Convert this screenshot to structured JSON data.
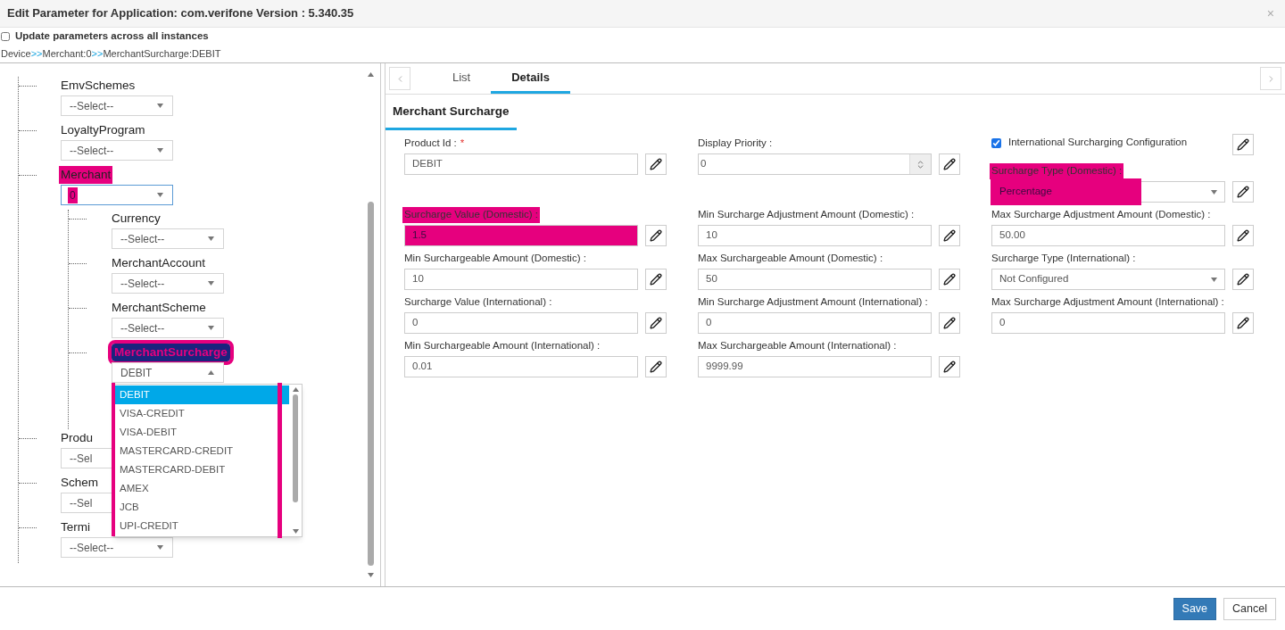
{
  "dialog": {
    "title": "Edit Parameter for Application: com.verifone Version : 5.340.35",
    "close": "×"
  },
  "update_all": {
    "label": "Update parameters across all instances",
    "checked": false
  },
  "breadcrumb": [
    {
      "label": "Device"
    },
    {
      "label": "Merchant:0"
    },
    {
      "label": "MerchantSurcharge:DEBIT"
    }
  ],
  "breadcrumb_separator": ">>",
  "tree": [
    {
      "label": "EmvSchemes",
      "selected": false,
      "label_highlighted": false,
      "select": {
        "value": "--Select--",
        "focused": false,
        "open": false,
        "value_highlighted": false
      }
    },
    {
      "label": "LoyaltyProgram",
      "selected": false,
      "label_highlighted": false,
      "select": {
        "value": "--Select--",
        "focused": false,
        "open": false,
        "value_highlighted": false
      }
    },
    {
      "label": "Merchant",
      "selected": false,
      "label_highlighted": true,
      "select": {
        "value": "0",
        "focused": true,
        "open": false,
        "value_highlighted": true
      },
      "children": [
        {
          "label": "Currency",
          "selected": false,
          "label_highlighted": false,
          "select": {
            "value": "--Select--",
            "focused": false,
            "open": false,
            "value_highlighted": false
          }
        },
        {
          "label": "MerchantAccount",
          "selected": false,
          "label_highlighted": false,
          "select": {
            "value": "--Select--",
            "focused": false,
            "open": false,
            "value_highlighted": false
          }
        },
        {
          "label": "MerchantScheme",
          "selected": false,
          "label_highlighted": false,
          "select": {
            "value": "--Select--",
            "focused": false,
            "open": false,
            "value_highlighted": false
          }
        },
        {
          "label": "MerchantSurcharge",
          "selected": true,
          "label_highlighted": true,
          "select": {
            "value": "DEBIT",
            "focused": false,
            "open": true,
            "value_highlighted": false,
            "annotated": true,
            "options": [
              {
                "label": "DEBIT",
                "selected": true
              },
              {
                "label": "VISA-CREDIT",
                "selected": false
              },
              {
                "label": "VISA-DEBIT",
                "selected": false
              },
              {
                "label": "MASTERCARD-CREDIT",
                "selected": false
              },
              {
                "label": "MASTERCARD-DEBIT",
                "selected": false
              },
              {
                "label": "AMEX",
                "selected": false
              },
              {
                "label": "JCB",
                "selected": false
              },
              {
                "label": "UPI-CREDIT",
                "selected": false
              }
            ]
          }
        }
      ]
    },
    {
      "label": "Produ",
      "selected": false,
      "label_highlighted": false,
      "select": {
        "value": "--Sel",
        "focused": false,
        "open": false,
        "value_highlighted": false
      }
    },
    {
      "label": "Schem",
      "selected": false,
      "label_highlighted": false,
      "select": {
        "value": "--Sel",
        "focused": false,
        "open": false,
        "value_highlighted": false
      }
    },
    {
      "label": "Termi",
      "selected": false,
      "label_highlighted": false,
      "select": {
        "value": "--Select--",
        "focused": false,
        "open": false,
        "value_highlighted": false
      }
    }
  ],
  "tabs": [
    {
      "label": "List",
      "selected": false
    },
    {
      "label": "Details",
      "selected": true
    }
  ],
  "section_title": "Merchant Surcharge",
  "columns": [
    [
      {
        "kind": "text",
        "label": "Product Id :",
        "required": "*",
        "value": "DEBIT",
        "label_highlighted": false,
        "value_highlighted": false
      },
      {
        "kind": "text",
        "label": "Surcharge Value (Domestic) :",
        "value": "1.5",
        "label_highlighted": true,
        "value_highlighted": true
      },
      {
        "kind": "text",
        "label": "Min Surchargeable Amount (Domestic) :",
        "value": "10",
        "label_highlighted": false,
        "value_highlighted": false
      },
      {
        "kind": "text",
        "label": "Surcharge Value (International) :",
        "value": "0",
        "label_highlighted": false,
        "value_highlighted": false
      },
      {
        "kind": "text",
        "label": "Min Surchargeable Amount (International) :",
        "value": "0.01",
        "label_highlighted": false,
        "value_highlighted": false
      }
    ],
    [
      {
        "kind": "number",
        "label": "Display Priority :",
        "value": "0",
        "label_highlighted": false,
        "value_highlighted": false
      },
      {
        "kind": "text",
        "label": "Min Surcharge Adjustment Amount (Domestic) :",
        "value": "10",
        "label_highlighted": false,
        "value_highlighted": false
      },
      {
        "kind": "text",
        "label": "Max Surchargeable Amount (Domestic) :",
        "value": "50",
        "label_highlighted": false,
        "value_highlighted": false
      },
      {
        "kind": "text",
        "label": "Min Surcharge Adjustment Amount (International) :",
        "value": "0",
        "label_highlighted": false,
        "value_highlighted": false
      },
      {
        "kind": "text",
        "label": "Max Surchargeable Amount (International) :",
        "value": "9999.99",
        "label_highlighted": false,
        "value_highlighted": false
      }
    ],
    [
      {
        "kind": "checkbox",
        "label": "International Surcharging Configuration",
        "checked": true
      },
      {
        "kind": "select",
        "label": "Surcharge Type (Domestic) :",
        "value": "Percentage",
        "label_highlighted": true,
        "value_highlighted": true
      },
      {
        "kind": "text",
        "label": "Max Surcharge Adjustment Amount (Domestic) :",
        "value": "50.00",
        "label_highlighted": false,
        "value_highlighted": false
      },
      {
        "kind": "select",
        "label": "Surcharge Type (International) :",
        "value": "Not Configured",
        "label_highlighted": false,
        "value_highlighted": false
      },
      {
        "kind": "text",
        "label": "Max Surcharge Adjustment Amount (International) :",
        "value": "0",
        "label_highlighted": false,
        "value_highlighted": false
      }
    ]
  ],
  "buttons": [
    {
      "label": "Save",
      "kind": "primary"
    },
    {
      "label": "Cancel",
      "kind": "secondary"
    }
  ]
}
